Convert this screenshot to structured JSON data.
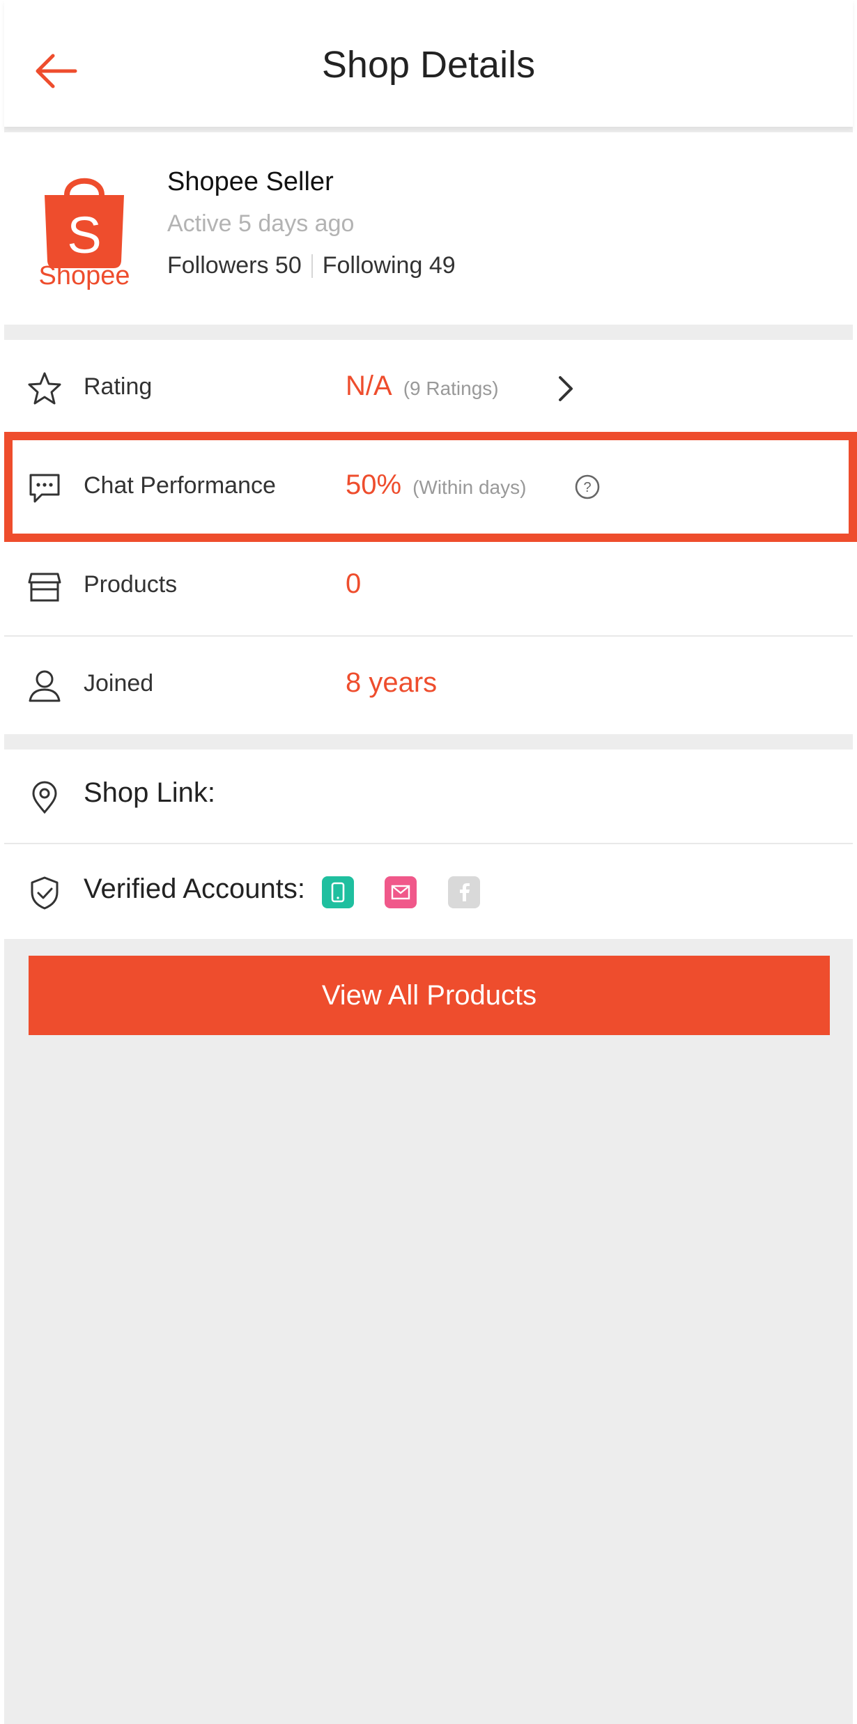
{
  "header": {
    "title": "Shop Details"
  },
  "shop": {
    "name": "Shopee Seller",
    "logo_text": "Shopee",
    "active": "Active 5 days ago",
    "followers": "Followers 50",
    "following": "Following 49"
  },
  "rows": {
    "rating": {
      "label": "Rating",
      "value": "N/A",
      "sub": "(9 Ratings)"
    },
    "chat": {
      "label": "Chat Performance",
      "value": "50%",
      "sub": "(Within days)"
    },
    "products": {
      "label": "Products",
      "value": "0"
    },
    "joined": {
      "label": "Joined",
      "value": "8 years"
    }
  },
  "shop_link": {
    "label": "Shop Link:"
  },
  "verified": {
    "label": "Verified Accounts:"
  },
  "button": {
    "label": "View All Products"
  },
  "colors": {
    "accent": "#ee4d2d",
    "phone_badge": "#1fbf9f",
    "email_badge": "#f0588a",
    "facebook_badge": "#d9d9d9"
  }
}
